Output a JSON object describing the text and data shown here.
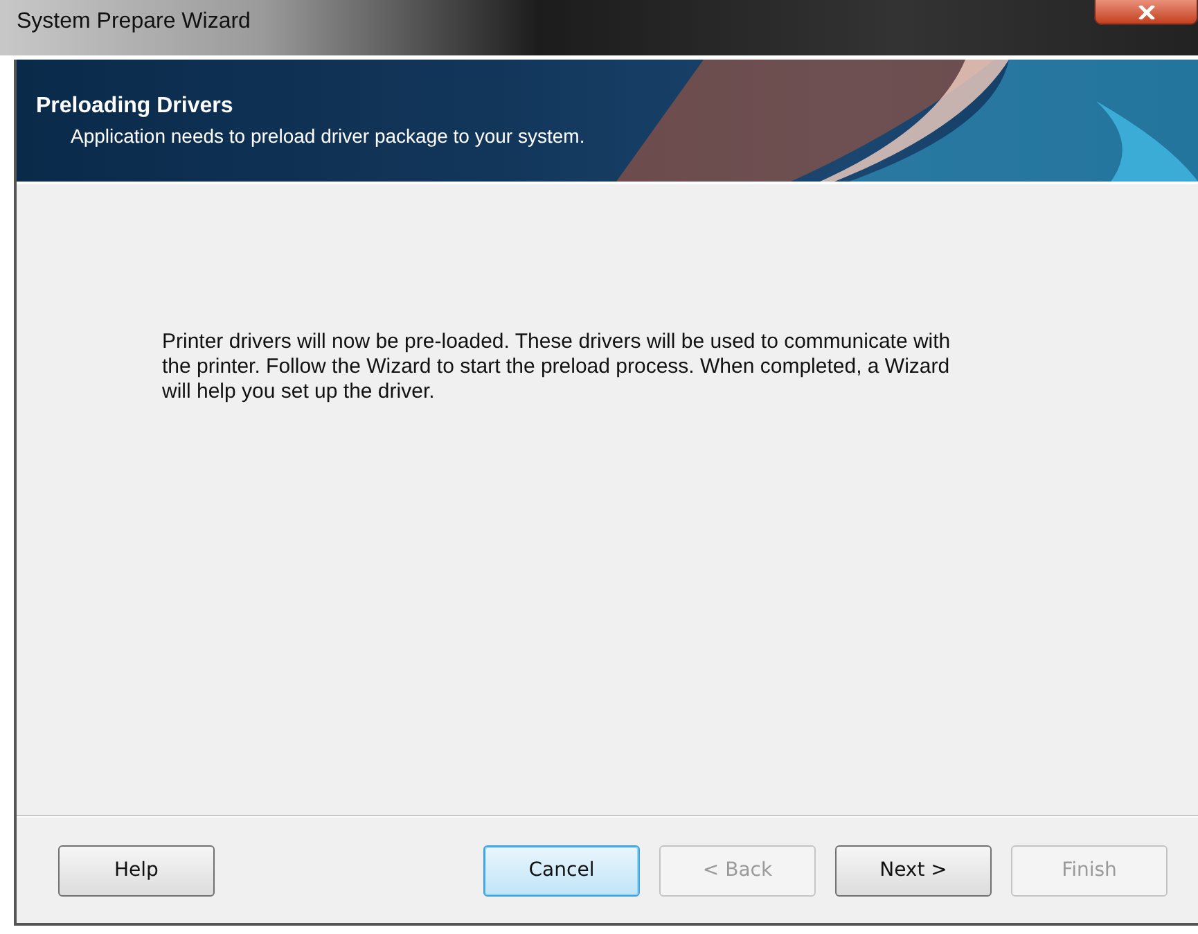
{
  "window": {
    "title": "System Prepare Wizard"
  },
  "header": {
    "title": "Preloading Drivers",
    "subtitle": "Application needs to preload driver package to your system."
  },
  "message": "Printer drivers will now be pre-loaded. These drivers will be used to communicate with the printer. Follow the Wizard to start the preload process. When completed, a Wizard will help you set up the driver.",
  "buttons": [
    {
      "label": "Help",
      "kind": "left",
      "disabled": false,
      "focused": false
    },
    {
      "label": "Cancel",
      "kind": "right",
      "disabled": false,
      "focused": true
    },
    {
      "label": "< Back",
      "kind": "right",
      "disabled": true,
      "focused": false
    },
    {
      "label": "Next >",
      "kind": "right",
      "disabled": false,
      "focused": false
    },
    {
      "label": "Finish",
      "kind": "right",
      "disabled": true,
      "focused": false
    }
  ]
}
